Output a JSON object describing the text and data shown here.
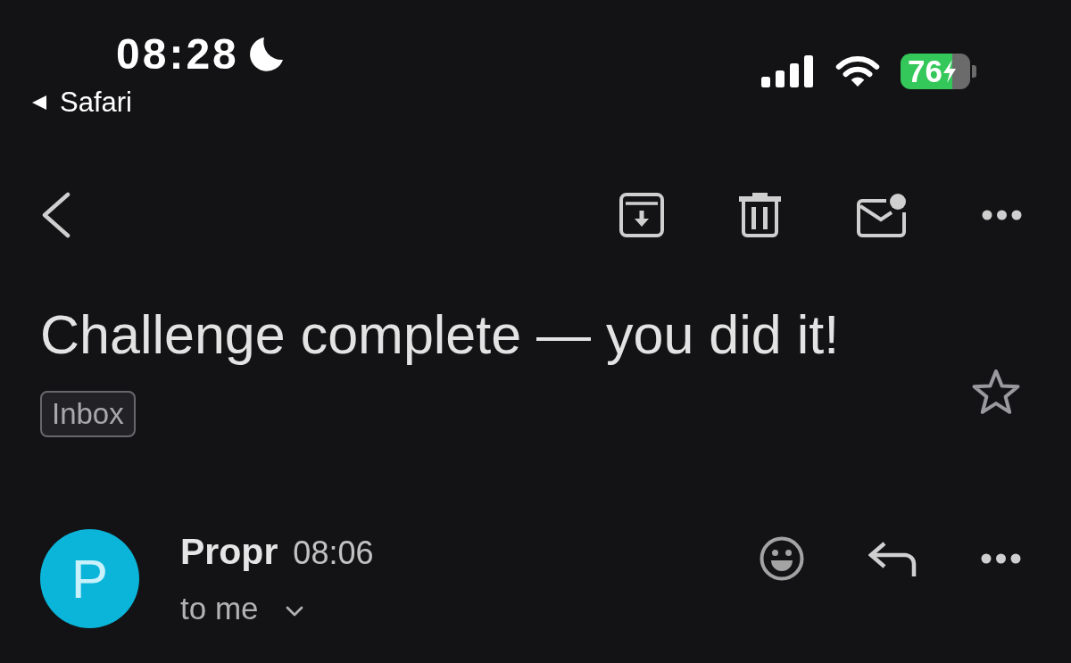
{
  "status_bar": {
    "time": "08:28",
    "return_app": "Safari",
    "battery": "76"
  },
  "message": {
    "subject": "Challenge complete — you did it!",
    "labels": [
      "Inbox"
    ],
    "starred": false,
    "sender": {
      "initial": "P",
      "name": "Propr",
      "time": "08:06",
      "recipient": "to me",
      "details_expanded": false
    }
  }
}
